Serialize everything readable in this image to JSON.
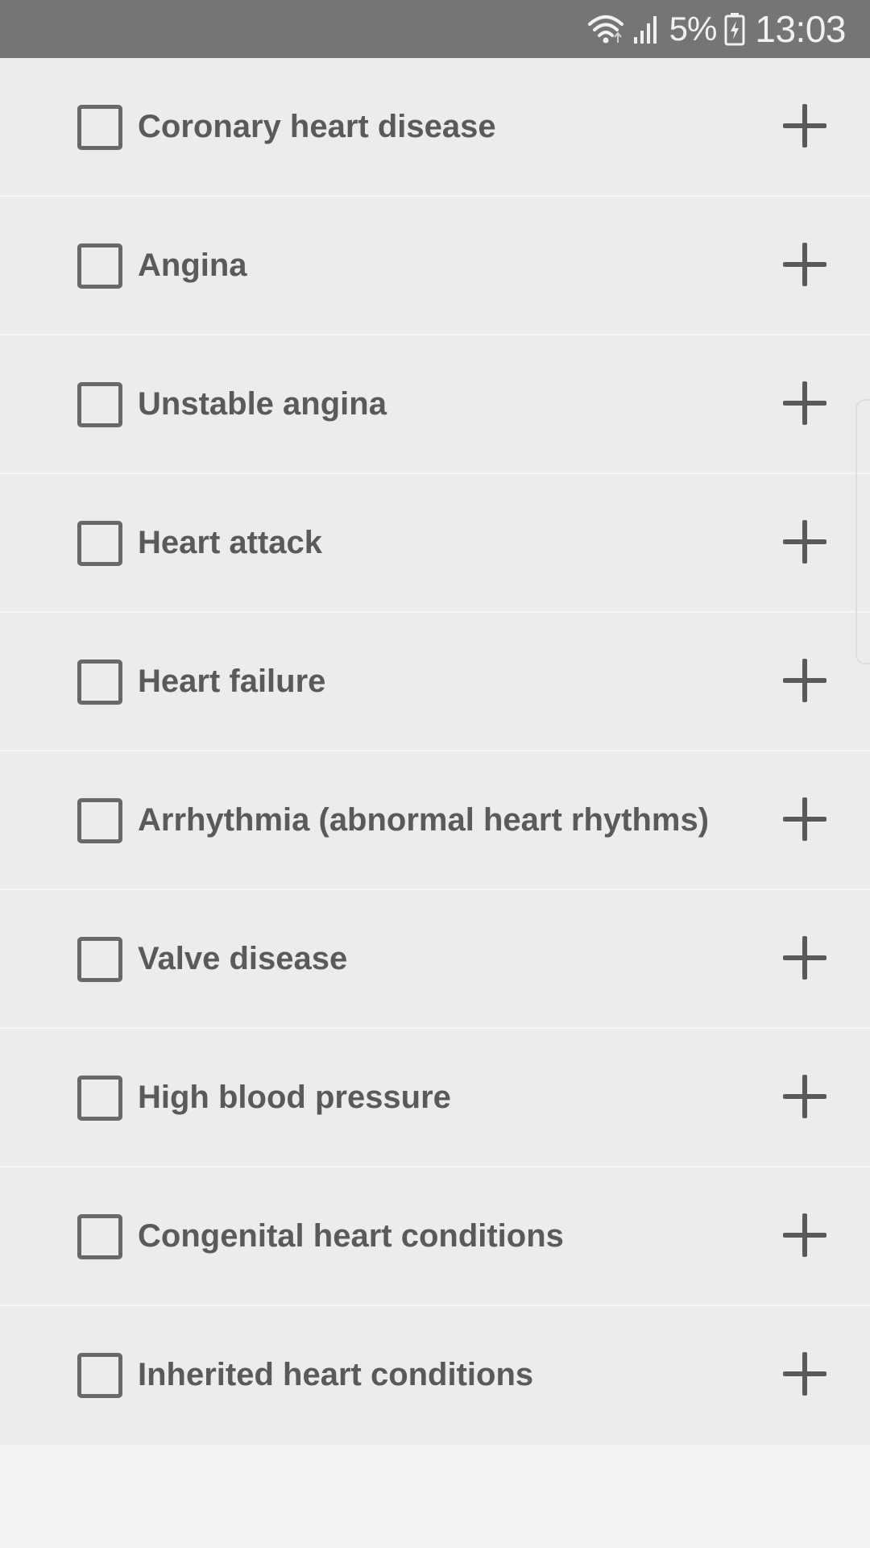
{
  "status_bar": {
    "battery_percent": "5%",
    "time": "13:03",
    "icons": [
      "wifi-icon",
      "signal-icon",
      "battery-icon"
    ]
  },
  "conditions": [
    {
      "label": "Coronary heart disease",
      "checked": false
    },
    {
      "label": "Angina",
      "checked": false
    },
    {
      "label": "Unstable angina",
      "checked": false
    },
    {
      "label": "Heart attack",
      "checked": false
    },
    {
      "label": "Heart failure",
      "checked": false
    },
    {
      "label": "Arrhythmia (abnormal heart rhythms)",
      "checked": false
    },
    {
      "label": "Valve disease",
      "checked": false
    },
    {
      "label": "High blood pressure",
      "checked": false
    },
    {
      "label": "Congenital heart conditions",
      "checked": false
    },
    {
      "label": "Inherited heart conditions",
      "checked": false
    }
  ],
  "colors": {
    "status_bar_bg": "#757575",
    "row_bg": "#ececec",
    "text": "#5a5a5a",
    "page_bg": "#f2f2f2"
  }
}
